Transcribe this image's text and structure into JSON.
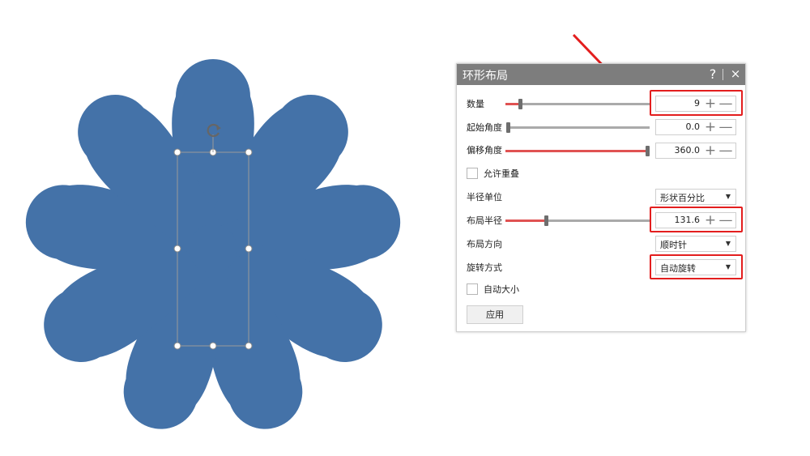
{
  "panel": {
    "title": "环形布局",
    "help_label": "?",
    "close_label": "×",
    "count": {
      "label": "数量",
      "value": "9",
      "level": 0.1
    },
    "start_angle": {
      "label": "起始角度",
      "value": "0.0",
      "level": 0.0
    },
    "offset_angle": {
      "label": "偏移角度",
      "value": "360.0",
      "level": 1.0
    },
    "allow_overlap": {
      "label": "允许重叠",
      "checked": false
    },
    "radius_unit": {
      "label": "半径单位",
      "selected": "形状百分比"
    },
    "layout_radius": {
      "label": "布局半径",
      "value": "131.6",
      "level": 0.28
    },
    "layout_direction": {
      "label": "布局方向",
      "selected": "顺时针"
    },
    "rotation_mode": {
      "label": "旋转方式",
      "selected": "自动旋转"
    },
    "auto_size": {
      "label": "自动大小",
      "checked": false
    },
    "apply_label": "应用",
    "plus_glyph": "+",
    "minus_glyph": "—",
    "dropdown_glyph": "▼"
  },
  "shape": {
    "petal_count": 9,
    "color": "#4472a8"
  },
  "colors": {
    "accent": "#e05252",
    "highlight": "#e31e1e",
    "titlebar": "#7d7d7d"
  }
}
